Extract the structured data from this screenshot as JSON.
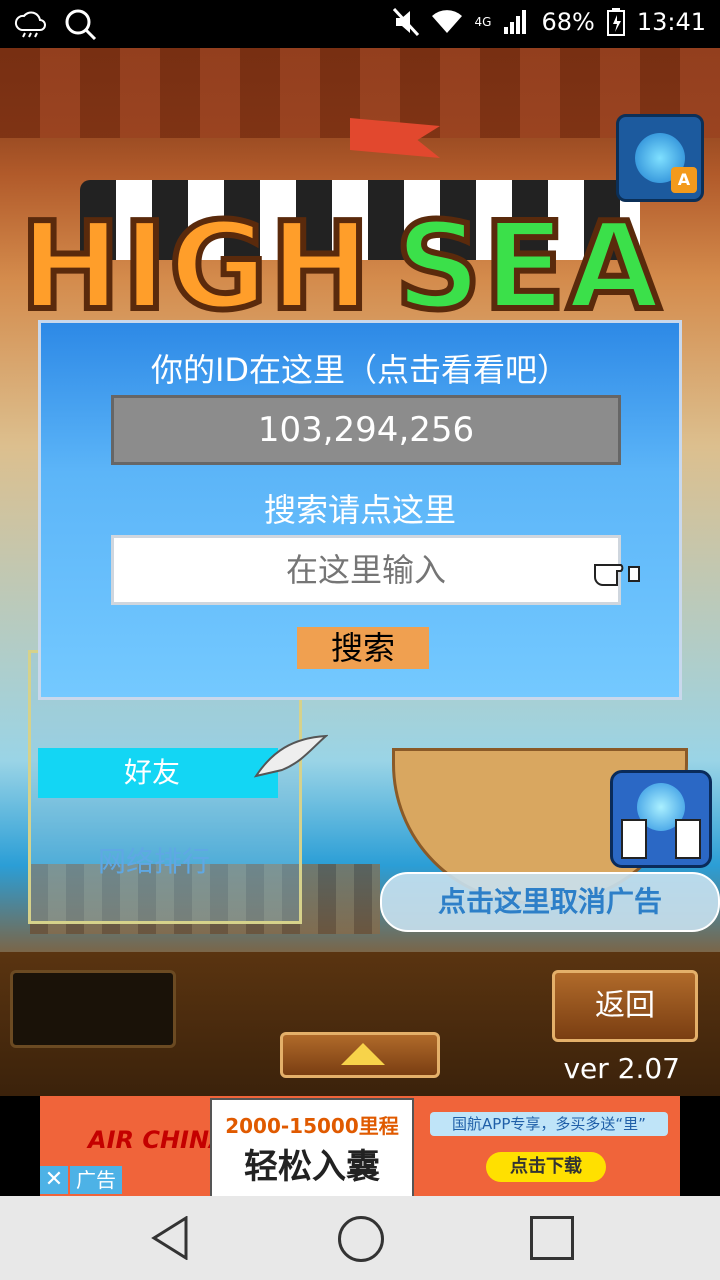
{
  "status_bar": {
    "battery": "68%",
    "time": "13:41",
    "network": "4G"
  },
  "game": {
    "logo_word1": "HIGH",
    "logo_word2": "SEA"
  },
  "dialog": {
    "id_title": "你的ID在这里（点击看看吧）",
    "id_value": "103,294,256",
    "search_title": "搜索请点这里",
    "search_placeholder": "在这里输入",
    "search_button": "搜索"
  },
  "panel": {
    "friend_tab": "好友",
    "ranking_label": "网络排行"
  },
  "buttons": {
    "cancel_ad": "点击这里取消广告",
    "back": "返回"
  },
  "version": "ver 2.07",
  "ad": {
    "brand": "AIR CHINA",
    "headline_small": "2000-15000里程",
    "headline_big": "轻松入囊",
    "promo": "国航APP专享，多买多送“里”",
    "download": "点击下载",
    "close": "✕",
    "label": "广告"
  }
}
